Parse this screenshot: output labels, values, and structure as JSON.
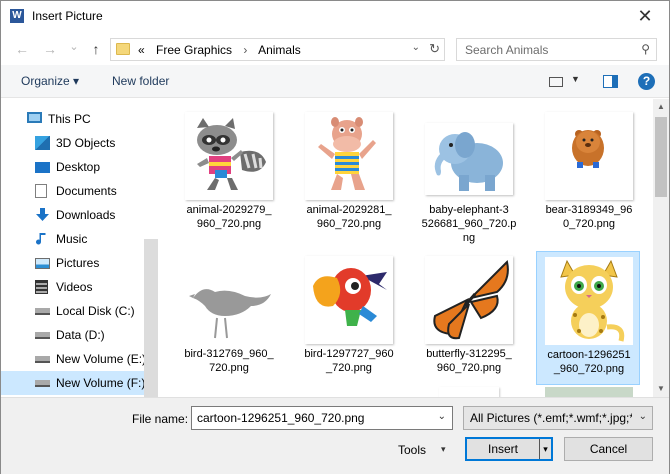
{
  "window": {
    "app_icon_letter": "W",
    "title": "Insert Picture",
    "close_glyph": "✕"
  },
  "address": {
    "back_glyph": "←",
    "forward_glyph": "→",
    "recent_glyph": "⌄",
    "up_glyph": "↑",
    "overflow": "«",
    "crumbs": [
      "Free Graphics",
      "Animals"
    ],
    "crumb_sep": "›",
    "search_placeholder": "Search Animals"
  },
  "toolbar": {
    "organize": "Organize ▾",
    "new_folder": "New folder",
    "view_drop": "▼",
    "help": "?"
  },
  "nav": {
    "items": [
      {
        "label": "This PC",
        "icon": "computer-icon",
        "top": true,
        "selected": false
      },
      {
        "label": "3D Objects",
        "icon": "3d-objects-icon",
        "top": false,
        "selected": false
      },
      {
        "label": "Desktop",
        "icon": "desktop-icon",
        "top": false,
        "selected": false
      },
      {
        "label": "Documents",
        "icon": "documents-icon",
        "top": false,
        "selected": false
      },
      {
        "label": "Downloads",
        "icon": "downloads-icon",
        "top": false,
        "selected": false
      },
      {
        "label": "Music",
        "icon": "music-icon",
        "top": false,
        "selected": false
      },
      {
        "label": "Pictures",
        "icon": "pictures-icon",
        "top": false,
        "selected": false
      },
      {
        "label": "Videos",
        "icon": "videos-icon",
        "top": false,
        "selected": false
      },
      {
        "label": "Local Disk (C:)",
        "icon": "drive-icon",
        "top": false,
        "selected": false
      },
      {
        "label": "Data (D:)",
        "icon": "drive-icon",
        "top": false,
        "selected": false
      },
      {
        "label": "New Volume (E:)",
        "icon": "drive-icon",
        "top": false,
        "selected": false
      },
      {
        "label": "New Volume (F:)",
        "icon": "drive-icon",
        "top": false,
        "selected": true
      }
    ]
  },
  "files": [
    {
      "name": "animal-2029279_960_720.png",
      "line1": "animal-2029279_",
      "line2": "960_720.png",
      "line3": "",
      "thumb": "raccoon"
    },
    {
      "name": "animal-2029281_960_720.png",
      "line1": "animal-2029281_",
      "line2": "960_720.png",
      "line3": "",
      "thumb": "hippo"
    },
    {
      "name": "baby-elephant-3526681_960_720.png",
      "line1": "baby-elephant-3",
      "line2": "526681_960_720.p",
      "line3": "ng",
      "thumb": "elephant"
    },
    {
      "name": "bear-3189349_960_720.png",
      "line1": "bear-3189349_96",
      "line2": "0_720.png",
      "line3": "",
      "thumb": "bear"
    },
    {
      "name": "bird-312769_960_720.png",
      "line1": "bird-312769_960_",
      "line2": "720.png",
      "line3": "",
      "thumb": "bird-silhouette"
    },
    {
      "name": "bird-1297727_960_720.png",
      "line1": "bird-1297727_960",
      "line2": "_720.png",
      "line3": "",
      "thumb": "parrot"
    },
    {
      "name": "butterfly-312295_960_720.png",
      "line1": "butterfly-312295_",
      "line2": "960_720.png",
      "line3": "",
      "thumb": "butterfly"
    },
    {
      "name": "cartoon-1296251_960_720.png",
      "line1": "cartoon-1296251",
      "line2": "_960_720.png",
      "line3": "",
      "thumb": "cheetah",
      "selected": true
    }
  ],
  "bottom": {
    "file_name_label": "File name:",
    "file_name_value": "cartoon-1296251_960_720.png",
    "file_type_value": "All Pictures (*.emf;*.wmf;*.jpg;*",
    "tools_label": "Tools",
    "insert_label": "Insert",
    "cancel_label": "Cancel",
    "drop_glyph": "▾"
  },
  "colors": {
    "selection": "#cce8ff",
    "selection_border": "#99d1ff",
    "accent": "#0078d7",
    "toolbar_text": "#1e395b"
  }
}
